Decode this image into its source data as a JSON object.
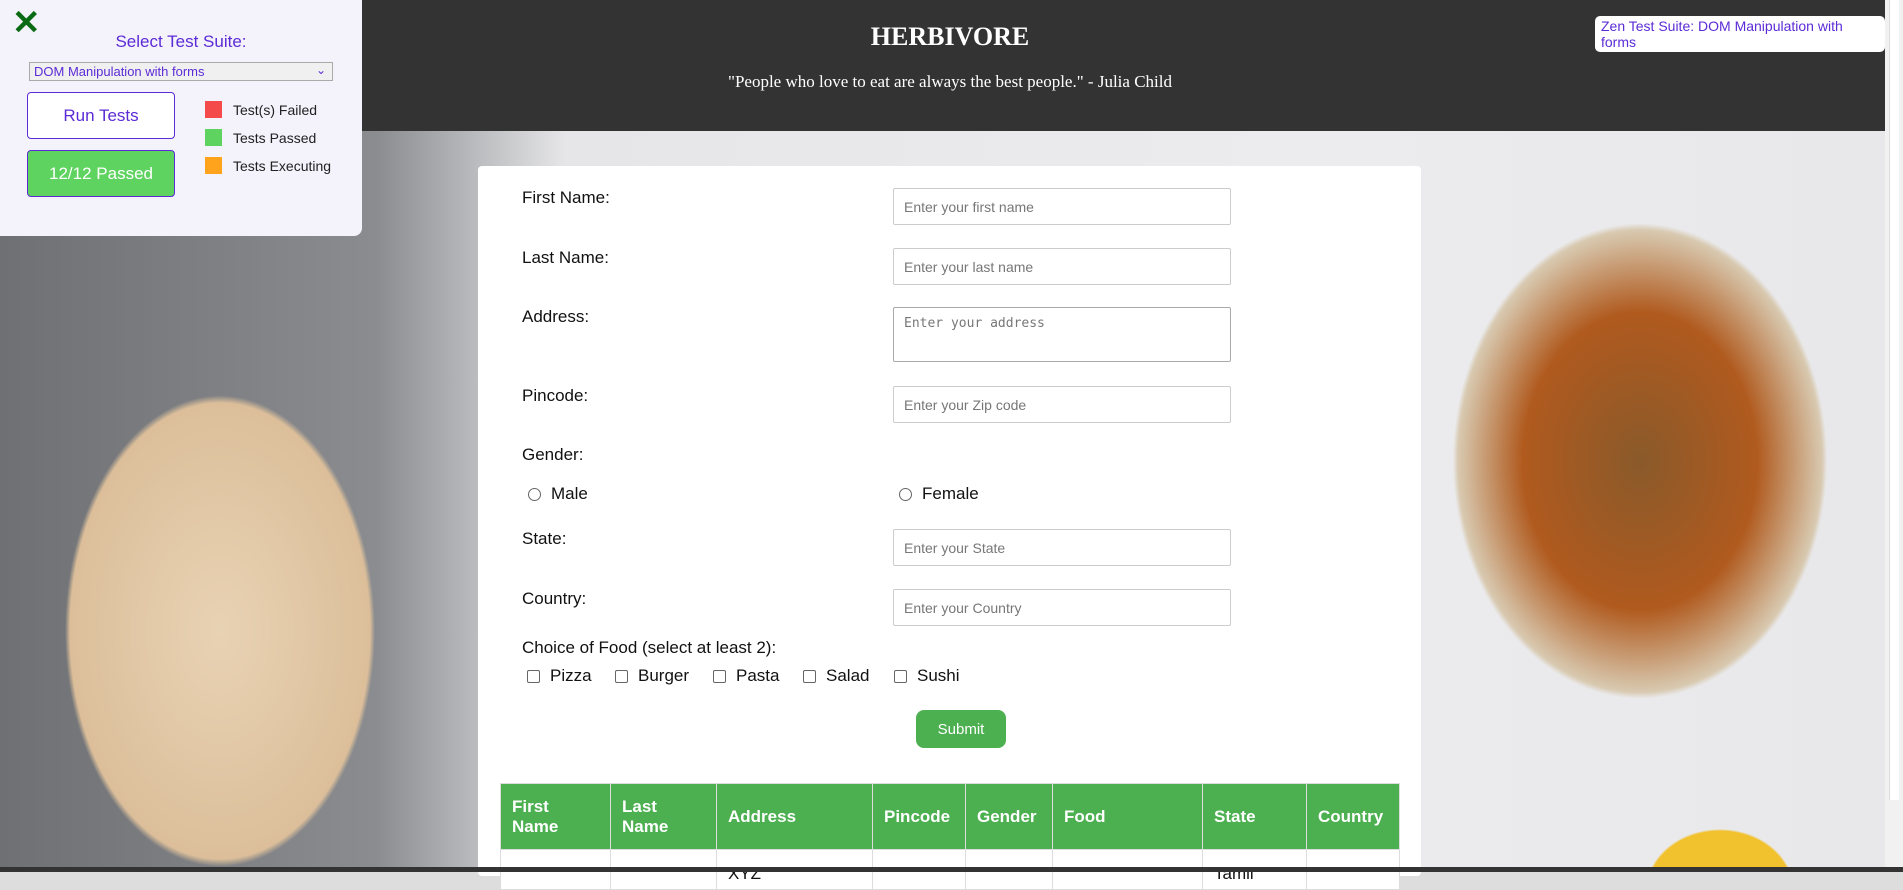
{
  "header": {
    "title": "HERBIVORE",
    "quote": "\"People who love to eat are always the best people.\" - Julia Child",
    "zen_badge": "Zen Test Suite: DOM Manipulation with forms"
  },
  "panel": {
    "select_label": "Select Test Suite:",
    "selected_suite": "DOM Manipulation with forms",
    "run_button": "Run Tests",
    "result_button": "12/12 Passed",
    "legend": [
      {
        "label": "Test(s) Failed",
        "color": "#f44a4a"
      },
      {
        "label": "Tests Passed",
        "color": "#5fd35f"
      },
      {
        "label": "Tests Executing",
        "color": "#ffa21c"
      }
    ]
  },
  "form": {
    "first_name": {
      "label": "First Name:",
      "placeholder": "Enter your first name"
    },
    "last_name": {
      "label": "Last Name:",
      "placeholder": "Enter your last name"
    },
    "address": {
      "label": "Address:",
      "placeholder": "Enter your address"
    },
    "pincode": {
      "label": "Pincode:",
      "placeholder": "Enter your Zip code"
    },
    "gender": {
      "label": "Gender:",
      "options": [
        "Male",
        "Female"
      ]
    },
    "state": {
      "label": "State:",
      "placeholder": "Enter your State"
    },
    "country": {
      "label": "Country:",
      "placeholder": "Enter your Country"
    },
    "food": {
      "label": "Choice of Food (select at least 2):",
      "options": [
        "Pizza",
        "Burger",
        "Pasta",
        "Salad",
        "Sushi"
      ]
    },
    "submit": "Submit"
  },
  "table": {
    "headers": [
      "First Name",
      "Last Name",
      "Address",
      "Pincode",
      "Gender",
      "Food",
      "State",
      "Country"
    ],
    "rows": [
      [
        "",
        "",
        "XYZ",
        "",
        "",
        "",
        "Tamil",
        ""
      ]
    ]
  }
}
